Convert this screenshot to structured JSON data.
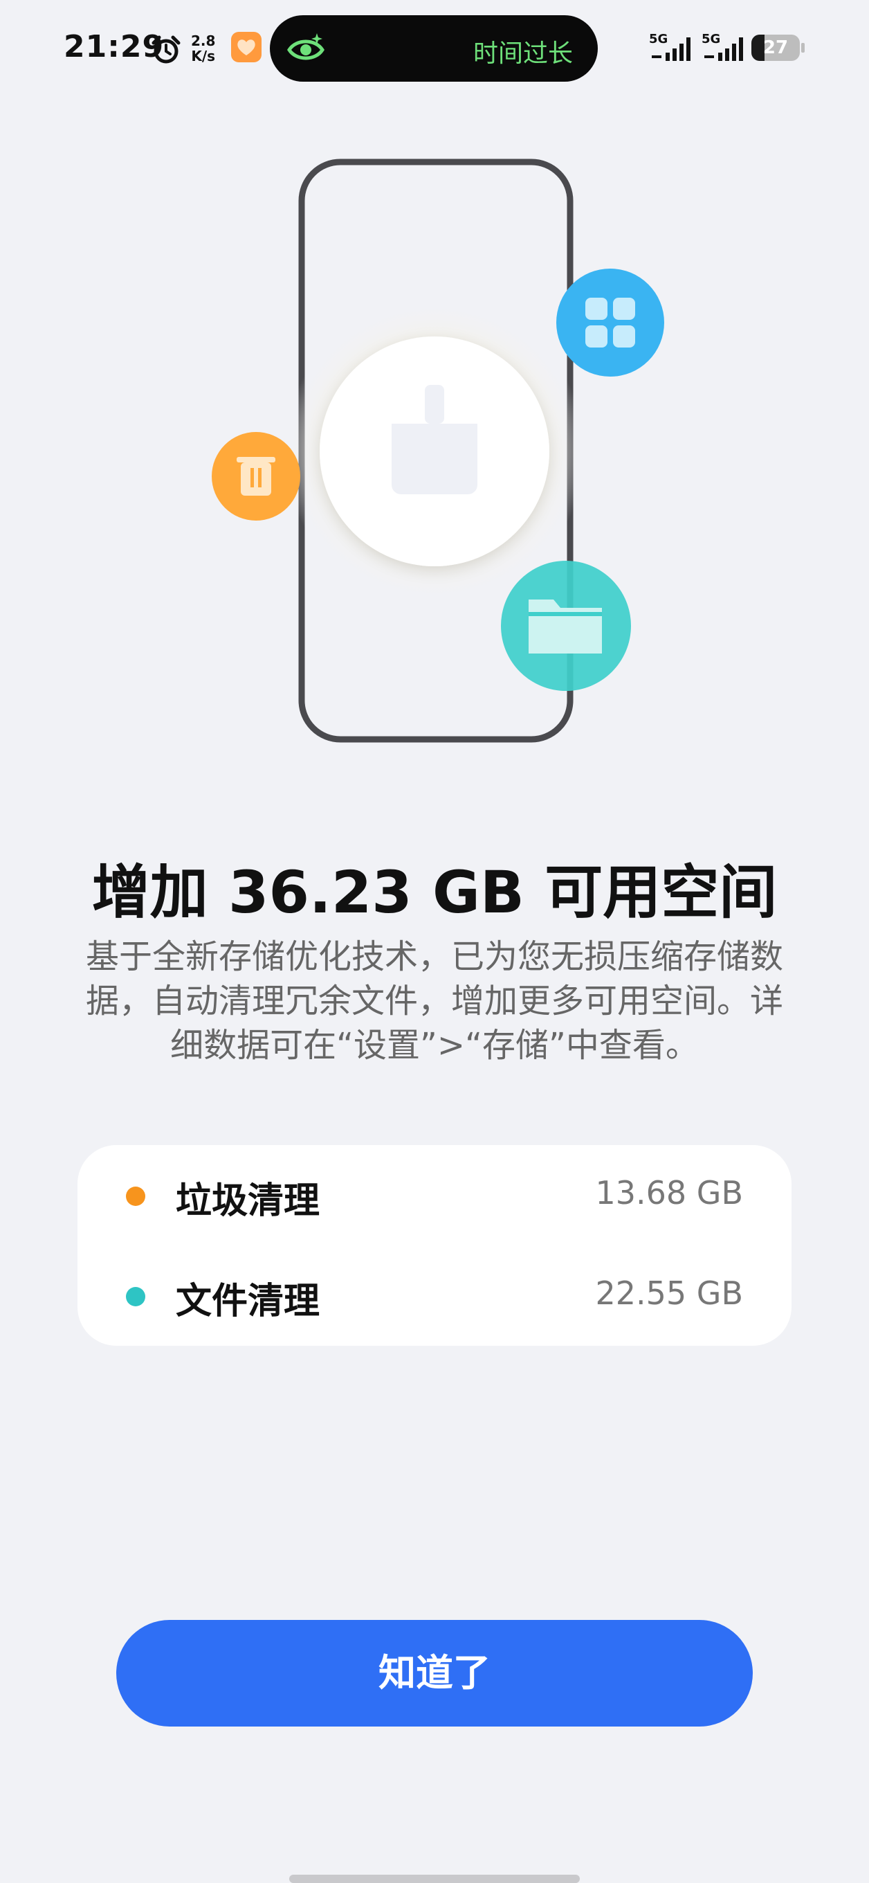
{
  "status_bar": {
    "time": "21:29",
    "net_speed_value": "2.8",
    "net_speed_unit": "K/s",
    "reminder_text": "时间过长",
    "signal_1_label": "5G",
    "signal_2_label": "5G",
    "battery_level": "27",
    "icons": [
      "alarm-icon",
      "health-app-icon",
      "eye-care-icon",
      "signal-icon",
      "battery-icon"
    ]
  },
  "colors": {
    "background": "#f1f2f6",
    "accent": "#2f6ff5",
    "junk_dot": "#f7941d",
    "file_dot": "#2ec4c4",
    "trash_bubble": "#ffa93a",
    "apps_bubble": "#3ab4f2",
    "folder_bubble": "#3fcfcb"
  },
  "illustration": {
    "icons": [
      "phone-outline-icon",
      "broom-icon",
      "trash-icon",
      "apps-grid-icon",
      "folder-icon"
    ]
  },
  "main": {
    "headline": "增加 36.23 GB 可用空间",
    "description": "基于全新存储优化技术，已为您无损压缩存储数据，自动清理冗余文件，增加更多可用空间。详细数据可在“设置”>“存储”中查看。"
  },
  "breakdown": [
    {
      "label": "垃圾清理",
      "value": "13.68 GB"
    },
    {
      "label": "文件清理",
      "value": "22.55 GB"
    }
  ],
  "actions": {
    "confirm_label": "知道了"
  }
}
